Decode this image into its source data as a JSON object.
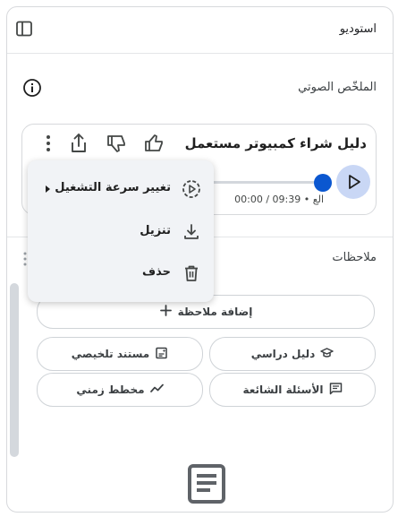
{
  "header": {
    "title": "استوديو"
  },
  "audio_overview": {
    "section_title": "الملخّص الصوتي",
    "card_title": "دليل شراء كمبيوتر مستعمل",
    "time_elapsed": "00:00",
    "time_total": "09:39",
    "time_trailing": "• الع",
    "progress_percent": 0
  },
  "menu": {
    "items": [
      {
        "label": "تغيير سرعة التشغيل",
        "icon": "playback-speed-icon"
      },
      {
        "label": "تنزيل",
        "icon": "download-icon"
      },
      {
        "label": "حذف",
        "icon": "trash-icon"
      }
    ]
  },
  "notes": {
    "section_title": "ملاحظات",
    "add_note_label": "إضافة ملاحظة",
    "buttons": [
      {
        "label": "دليل دراسي",
        "icon": "school-icon"
      },
      {
        "label": "مستند تلخيصي",
        "icon": "summary-doc-icon"
      },
      {
        "label": "الأسئلة الشائعة",
        "icon": "faq-icon"
      },
      {
        "label": "مخطط زمني",
        "icon": "timeline-icon"
      }
    ]
  },
  "colors": {
    "accent": "#0b57d0",
    "play_button_bg": "#c9d7f5",
    "menu_bg": "#f1f3f6"
  }
}
